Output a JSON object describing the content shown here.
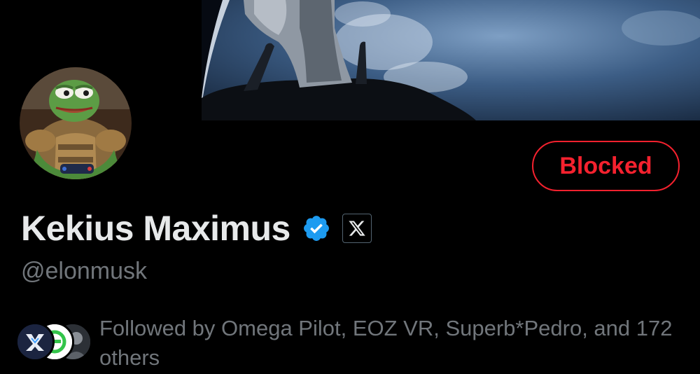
{
  "profile": {
    "display_name": "Kekius Maximus",
    "handle": "@elonmusk",
    "blocked_label": "Blocked",
    "verified_icon": "verified-check-icon",
    "affiliate_icon": "x-logo-icon"
  },
  "followers": {
    "text": "Followed by Omega Pilot, EOZ VR, Superb*Pedro, and 172 others",
    "avatars": [
      "omega-pilot-avatar",
      "eoz-vr-avatar",
      "superb-pedro-avatar"
    ]
  },
  "colors": {
    "background": "#000000",
    "blocked_red": "#f4212e",
    "verified_blue": "#1d9bf0",
    "secondary_text": "#71767b",
    "primary_text": "#e7e9ea"
  }
}
